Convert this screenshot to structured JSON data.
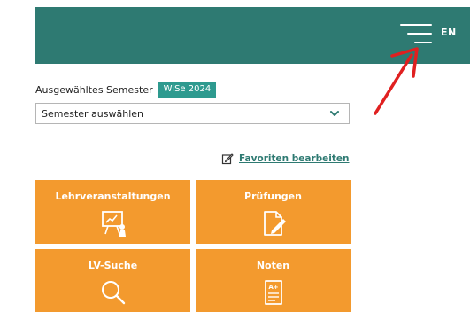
{
  "header": {
    "lang_label": "EN",
    "menu_icon": "hamburger-menu-icon",
    "bg_color": "#2e7a72"
  },
  "semester": {
    "label": "Ausgewähltes Semester",
    "badge": "WiSe 2024",
    "select_value": "Semester auswählen"
  },
  "favorites": {
    "link_label": "Favoriten bearbeiten",
    "icon": "edit-icon"
  },
  "tiles": [
    {
      "label": "Lehrveranstaltungen",
      "icon": "presentation-icon"
    },
    {
      "label": "Prüfungen",
      "icon": "exam-edit-icon"
    },
    {
      "label": "LV-Suche",
      "icon": "search-icon"
    },
    {
      "label": "Noten",
      "icon": "grades-icon"
    }
  ],
  "colors": {
    "accent": "#2e9a8f",
    "tile": "#f39a2e",
    "annotation_arrow": "#e02020"
  }
}
